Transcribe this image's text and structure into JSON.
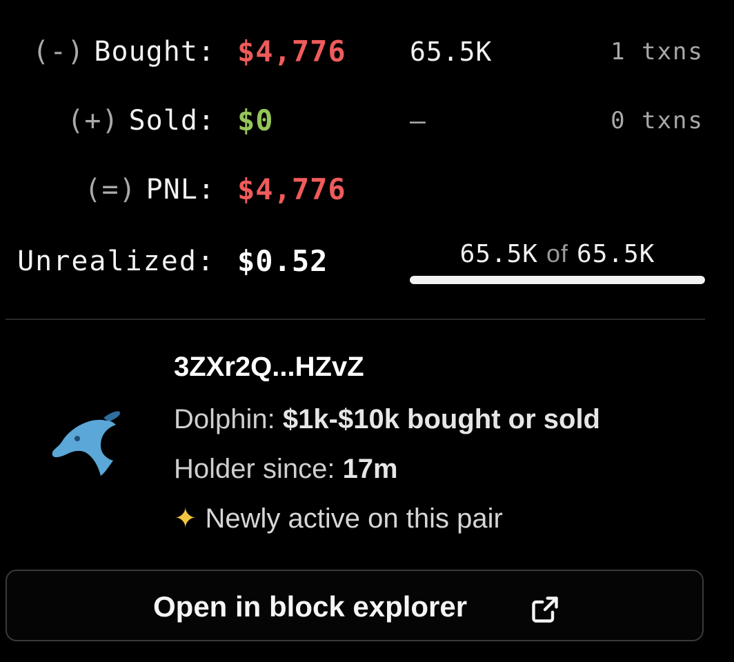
{
  "stats": {
    "bought": {
      "sign": "(-)",
      "label": "Bought:",
      "value": "$4,776",
      "amount": "65.5K",
      "txns": "1 txns"
    },
    "sold": {
      "sign": "(+)",
      "label": "Sold:",
      "value": "$0",
      "amount": "–",
      "txns": "0 txns"
    },
    "pnl": {
      "sign": "(=)",
      "label": "PNL:",
      "value": "$4,776"
    },
    "unrealized": {
      "label": "Unrealized:",
      "value": "$0.52"
    }
  },
  "holding": {
    "held": "65.5K",
    "of": "of",
    "total": "65.5K",
    "fraction": 1.0
  },
  "wallet": {
    "address": "3ZXr2Q...HZvZ",
    "icon": "dolphin-icon",
    "tier_label": "Dolphin:",
    "tier_value": "$1k-$10k bought or sold",
    "since_label": "Holder since:",
    "since_value": "17m",
    "sparkle_icon": "sparkles-icon",
    "newly_active": "Newly active on this pair"
  },
  "actions": {
    "open_explorer": "Open in block explorer",
    "external_icon": "external-link-icon"
  },
  "colors": {
    "negative": "#ef5b5b",
    "positive": "#96c55a",
    "dolphin": "#5aa7d8",
    "background": "#000000"
  }
}
